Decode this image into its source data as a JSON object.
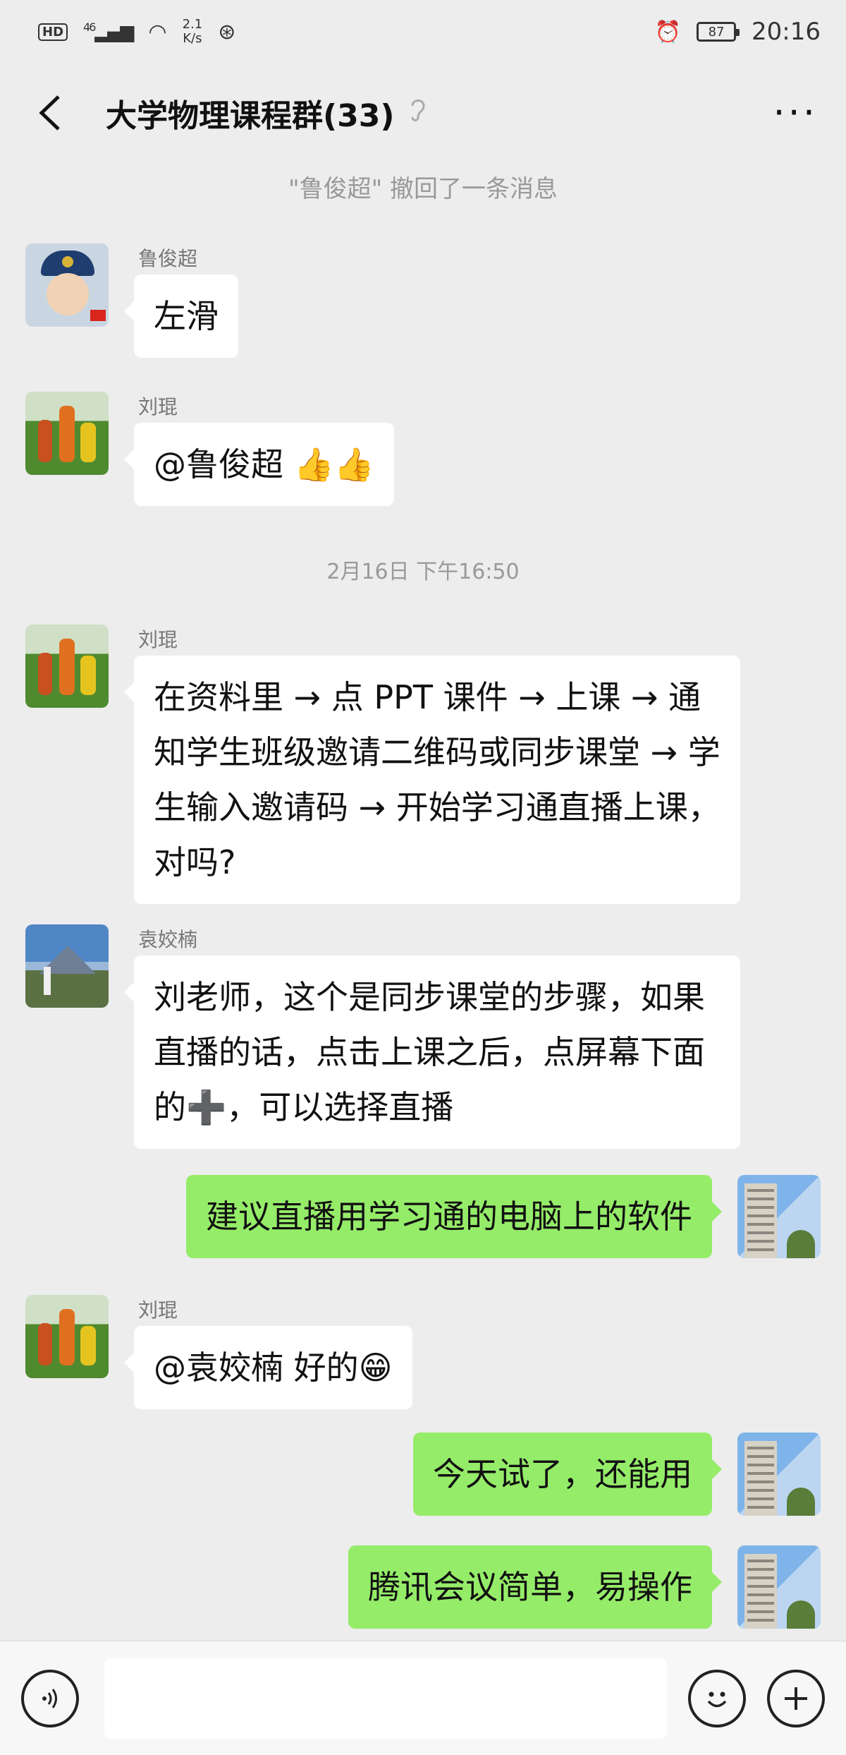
{
  "status_bar": {
    "hd": "HD",
    "network": "46",
    "speed_value": "2.1",
    "speed_unit": "K/s",
    "battery": "87",
    "time": "20:16"
  },
  "header": {
    "back_icon": "chevron-left-icon",
    "title": "大学物理课程群(33)",
    "mute_icon": "ear-icon",
    "more_icon": "more-dots-icon"
  },
  "chat": {
    "recall_notice": "\"鲁俊超\" 撤回了一条消息",
    "timestamp": "2月16日 下午16:50",
    "messages": [
      {
        "sender": "鲁俊超",
        "text": "左滑"
      },
      {
        "sender": "刘琨",
        "text": "@鲁俊超"
      },
      {
        "sender": "刘琨",
        "text": "在资料里 → 点 PPT 课件 → 上课 → 通知学生班级邀请二维码或同步课堂 → 学生输入邀请码 → 开始学习通直播上课，对吗?"
      },
      {
        "sender": "袁姣楠",
        "text_part1": "刘老师，这个是同步课堂的步骤，如果直播的话，点击上课之后，点屏幕下面的",
        "text_part2": "，可以选择直播"
      },
      {
        "sender": "",
        "text": "建议直播用学习通的电脑上的软件"
      },
      {
        "sender": "刘琨",
        "text": "@袁姣楠  好的"
      },
      {
        "sender": "",
        "text": "今天试了，还能用"
      },
      {
        "sender": "",
        "text": "腾讯会议简单，易操作"
      }
    ]
  },
  "input_bar": {
    "voice_icon": "voice-icon",
    "placeholder": "",
    "emoji_icon": "smiley-icon",
    "add_icon": "plus-circle-icon"
  }
}
